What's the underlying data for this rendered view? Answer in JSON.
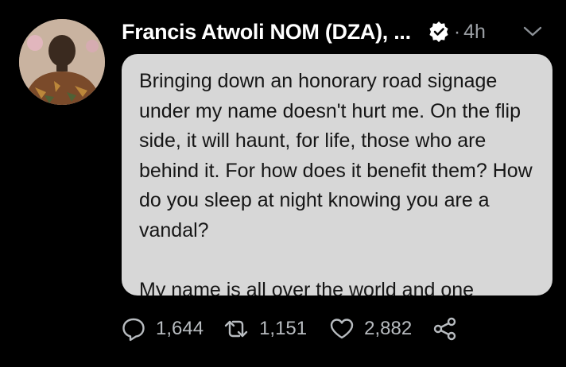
{
  "tweet": {
    "author": "Francis Atwoli NOM (DZA), ...",
    "verified": true,
    "time_separator": "·",
    "time": "4h",
    "text": "Bringing down an honorary road signage under my name doesn't hurt me. On the flip side, it will haunt, for life, those who are behind it. For how does it benefit them? How do you sleep at night knowing you are a vandal?\n\nMy name is all over the world and one"
  },
  "actions": {
    "replies": "1,644",
    "retweets": "1,151",
    "likes": "2,882"
  },
  "icons": {
    "verified": "verified-badge-icon",
    "menu": "chevron-down-icon",
    "reply": "reply-icon",
    "retweet": "retweet-icon",
    "like": "heart-icon",
    "share": "share-icon"
  },
  "colors": {
    "background": "#000000",
    "bubble": "#d7d7d7",
    "text_secondary": "#9a9ea3"
  }
}
